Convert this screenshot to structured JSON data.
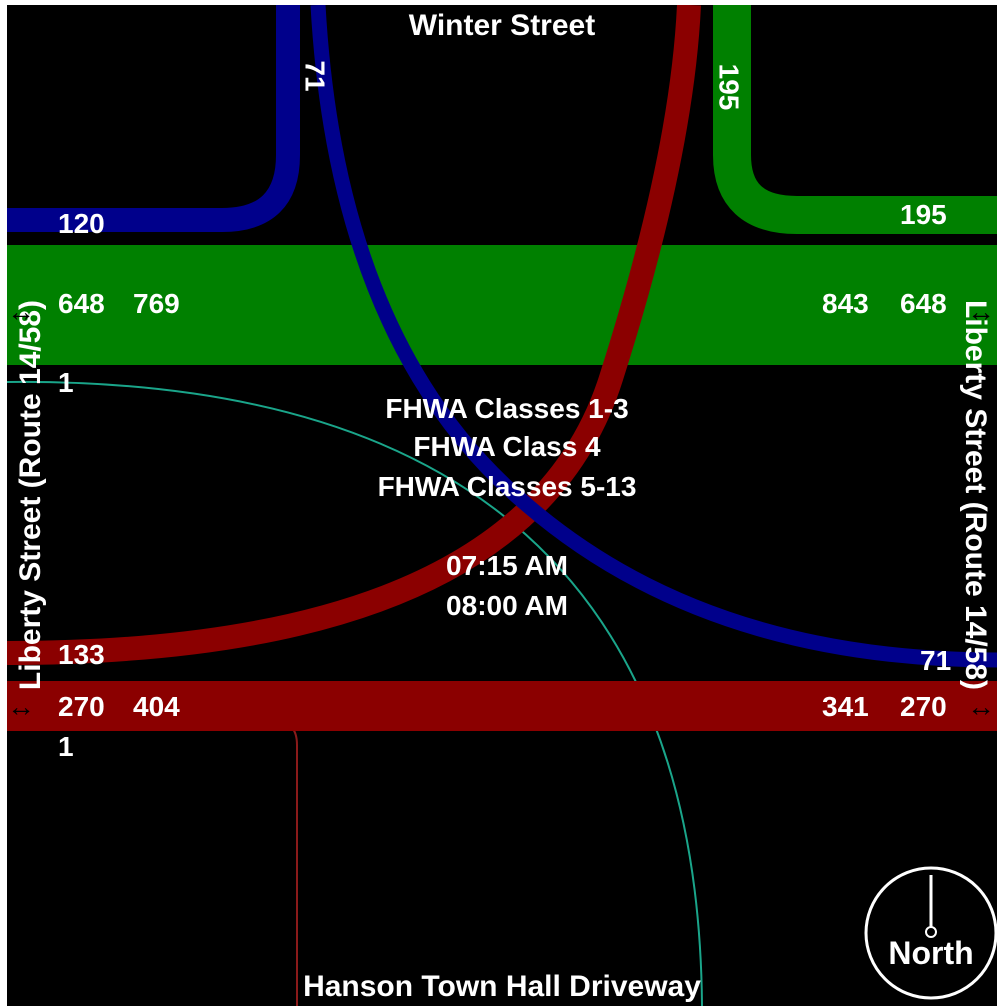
{
  "streets": {
    "north": "Winter Street",
    "south": "Hanson Town Hall Driveway",
    "west": "Liberty Street (Route 14/58)",
    "east": "Liberty Street (Route 14/58)"
  },
  "legend": {
    "class_1_3": "FHWA Classes 1-3",
    "class_4": "FHWA Class 4",
    "class_5_13": "FHWA Classes 5-13"
  },
  "time": {
    "start": "07:15 AM",
    "end": "08:00 AM"
  },
  "colors": {
    "background": "#000000",
    "eastbound_flow": "#008000",
    "westbound_flow": "#8b0000",
    "winter_flow": "#00008b",
    "minor_green_line": "#1aa58a",
    "minor_red_line": "#8b1a1a"
  },
  "volumes": {
    "nw_turn": "120",
    "winter_in": "71",
    "winter_out": "195",
    "ne_turn": "195",
    "green_left_1": "648",
    "green_left_2": "769",
    "green_right_1": "843",
    "green_right_2": "648",
    "minor_left_1": "1",
    "red_left_turn": "133",
    "blue_right_turn": "71",
    "red_left_1": "270",
    "red_left_2": "404",
    "red_right_1": "341",
    "red_right_2": "270",
    "minor_left_2": "1"
  },
  "compass": {
    "label": "North"
  }
}
